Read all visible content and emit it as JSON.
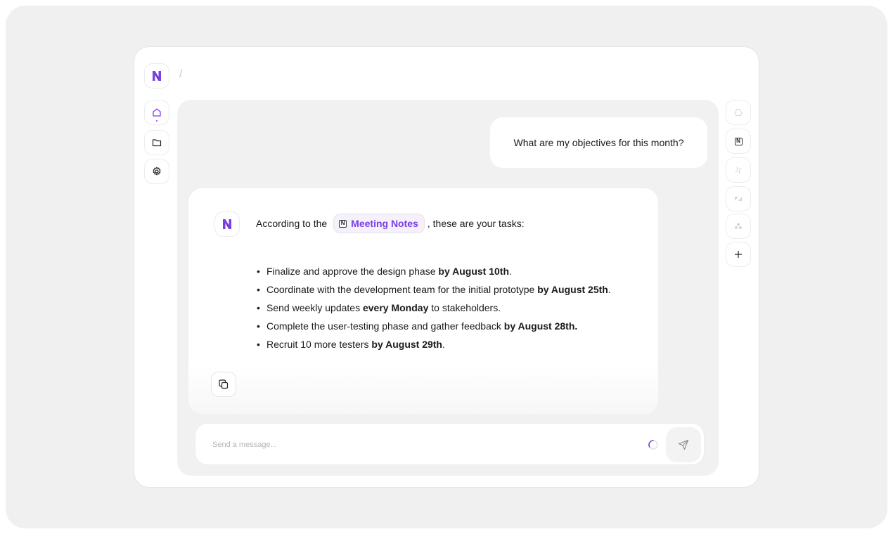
{
  "app": {
    "logo_icon": "brand-n-logo-icon",
    "breadcrumb_separator": "/",
    "accent_color": "#7b3fe4"
  },
  "sidebar": {
    "items": [
      {
        "name": "home",
        "icon": "home-icon",
        "active": true
      },
      {
        "name": "files",
        "icon": "folder-icon",
        "active": false
      },
      {
        "name": "settings",
        "icon": "gear-icon",
        "active": false
      }
    ]
  },
  "chat": {
    "user_message": "What are my objectives for this month?",
    "assistant": {
      "intro_before": "According to the",
      "source_chip": {
        "icon": "notion-icon",
        "label": "Meeting Notes"
      },
      "intro_after": ", these are your tasks:",
      "tasks": [
        {
          "text": "Finalize and approve the design phase ",
          "bold": "by August 10th",
          "tail": "."
        },
        {
          "text": "Coordinate with the development team for the initial prototype ",
          "bold": "by August 25th",
          "tail": "."
        },
        {
          "text": "Send weekly updates ",
          "bold": "every Monday",
          "tail": " to stakeholders."
        },
        {
          "text": "Complete the user-testing phase and gather feedback ",
          "bold": "by August 28th.",
          "tail": ""
        },
        {
          "text": "Recruit 10 more testers ",
          "bold": "by August 29th",
          "tail": "."
        }
      ],
      "copy_icon": "copy-icon"
    }
  },
  "composer": {
    "placeholder": "Send a message...",
    "value": "",
    "loading_icon": "spinner-icon",
    "send_icon": "send-icon"
  },
  "integrations": {
    "items": [
      {
        "name": "google-drive",
        "icon": "google-drive-icon",
        "active": false
      },
      {
        "name": "notion",
        "icon": "notion-icon",
        "active": true
      },
      {
        "name": "slack",
        "icon": "slack-icon",
        "active": false
      },
      {
        "name": "zendesk",
        "icon": "zendesk-icon",
        "active": false
      },
      {
        "name": "asana",
        "icon": "asana-icon",
        "active": false
      }
    ],
    "add_icon": "plus-icon"
  }
}
